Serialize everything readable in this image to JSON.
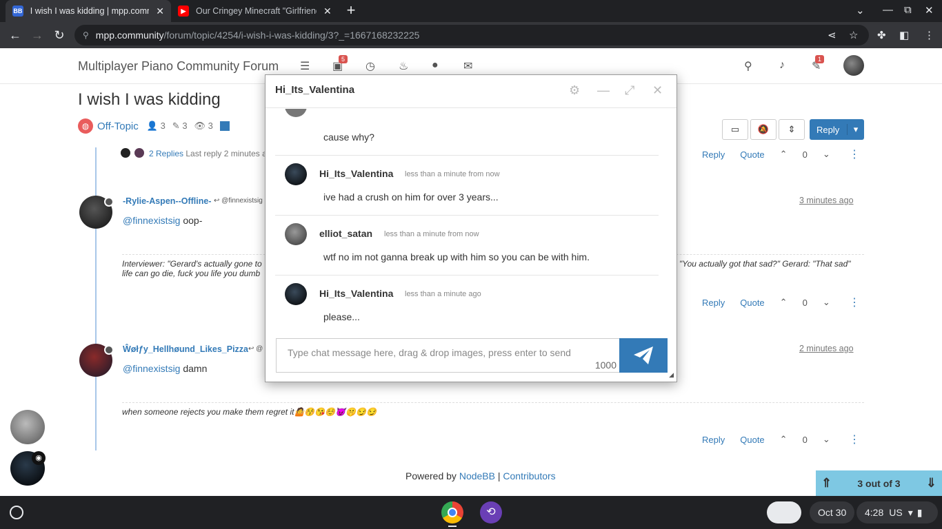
{
  "browser": {
    "tabs": [
      {
        "title": "I wish I was kidding | mpp.comm",
        "favicon": "BB",
        "active": true
      },
      {
        "title": "Our Cringey Minecraft \"Girlfriend",
        "favicon": "youtube",
        "active": false
      }
    ],
    "url_host": "mpp.community",
    "url_path": "/forum/topic/4254/i-wish-i-was-kidding/3?_=1667168232225"
  },
  "forum": {
    "brand": "Multiplayer Piano Community Forum",
    "unread_badge": "5",
    "chat_badge": "1"
  },
  "topic": {
    "title": "I wish I was kidding",
    "category": "Off-Topic",
    "posters": "3",
    "posts": "3",
    "views": "3",
    "reply_label": "Reply"
  },
  "thread": {
    "replies_label": "2 Replies",
    "last_reply": "Last reply 2 minutes ago",
    "actions": {
      "reply": "Reply",
      "quote": "Quote",
      "votes": "0"
    },
    "posts": [
      {
        "user": "-Rylie-Aspen--Offline-",
        "reply_to": "@finnexistsig",
        "time": "3 minutes ago",
        "mention": "@finnexistsig",
        "text": "oop-",
        "signature_1": "Interviewer: \"Gerard's actually gone to",
        "signature_1_end": "\"You actually got that sad?\" Gerard: \"That sad\"",
        "signature_2": "life can go die, fuck you life you dumb"
      },
      {
        "user": "Ŵøłƒy_Hellhøund_Likes_Pizza",
        "reply_to": "@",
        "time": "2 minutes ago",
        "mention": "@finnexistsig",
        "text": "damn",
        "signature": "when someone rejects you make them regret it🤷😚😘☺️😈🤫😏😏"
      }
    ]
  },
  "footer": {
    "powered": "Powered by ",
    "nodebb": "NodeBB",
    "sep": " | ",
    "contributors": "Contributors"
  },
  "pager": {
    "label": "3 out of 3"
  },
  "chat": {
    "title": "Hi_Its_Valentina",
    "messages": [
      {
        "user": "",
        "time": "",
        "text": "cause why?"
      },
      {
        "user": "Hi_Its_Valentina",
        "time": "less than a minute from now",
        "text": "ive had a crush on him for over 3 years..."
      },
      {
        "user": "elliot_satan",
        "time": "less than a minute from now",
        "text": "wtf no im not ganna break up with him so you can be with him."
      },
      {
        "user": "Hi_Its_Valentina",
        "time": "less than a minute ago",
        "text": "please..."
      }
    ],
    "input_placeholder": "Type chat message here, drag & drop images, press enter to send",
    "char_limit": "1000"
  },
  "shelf": {
    "date": "Oct 30",
    "time": "4:28",
    "locale": "US"
  },
  "icons": [
    "shield-icon",
    "search-icon",
    "bell-icon",
    "chat-icon",
    "gear-icon",
    "minimize-icon",
    "expand-icon",
    "close-icon",
    "send-icon",
    "share-icon",
    "star-icon",
    "puzzle-icon",
    "sidepanel-icon"
  ],
  "colors": {
    "accent": "#337ab7",
    "category": "#e95c5c",
    "pager": "#7ec8e3",
    "badge": "#d9534f"
  }
}
